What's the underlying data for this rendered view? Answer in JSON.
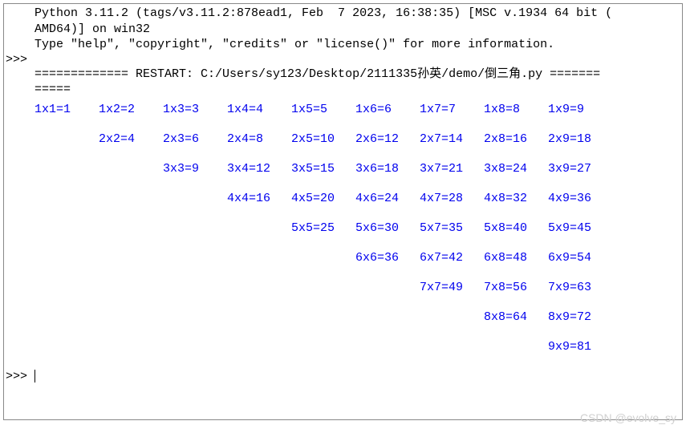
{
  "header": {
    "version_line_1": "Python 3.11.2 (tags/v3.11.2:878ead1, Feb  7 2023, 16:38:35) [MSC v.1934 64 bit (",
    "version_line_2": "AMD64)] on win32",
    "help_line": "Type \"help\", \"copyright\", \"credits\" or \"license()\" for more information."
  },
  "prompt": ">>>",
  "restart": {
    "line1": "============= RESTART: C:/Users/sy123/Desktop/2111335孙英/demo/倒三角.py =======",
    "line2": "====="
  },
  "table": {
    "rows": [
      [
        "1x1=1",
        "1x2=2",
        "1x3=3",
        "1x4=4",
        "1x5=5",
        "1x6=6",
        "1x7=7",
        "1x8=8",
        "1x9=9"
      ],
      [
        "",
        "2x2=4",
        "2x3=6",
        "2x4=8",
        "2x5=10",
        "2x6=12",
        "2x7=14",
        "2x8=16",
        "2x9=18"
      ],
      [
        "",
        "",
        "3x3=9",
        "3x4=12",
        "3x5=15",
        "3x6=18",
        "3x7=21",
        "3x8=24",
        "3x9=27"
      ],
      [
        "",
        "",
        "",
        "4x4=16",
        "4x5=20",
        "4x6=24",
        "4x7=28",
        "4x8=32",
        "4x9=36"
      ],
      [
        "",
        "",
        "",
        "",
        "5x5=25",
        "5x6=30",
        "5x7=35",
        "5x8=40",
        "5x9=45"
      ],
      [
        "",
        "",
        "",
        "",
        "",
        "6x6=36",
        "6x7=42",
        "6x8=48",
        "6x9=54"
      ],
      [
        "",
        "",
        "",
        "",
        "",
        "",
        "7x7=49",
        "7x8=56",
        "7x9=63"
      ],
      [
        "",
        "",
        "",
        "",
        "",
        "",
        "",
        "8x8=64",
        "8x9=72"
      ],
      [
        "",
        "",
        "",
        "",
        "",
        "",
        "",
        "",
        "9x9=81"
      ]
    ]
  },
  "watermark": "CSDN @evolve_sy"
}
